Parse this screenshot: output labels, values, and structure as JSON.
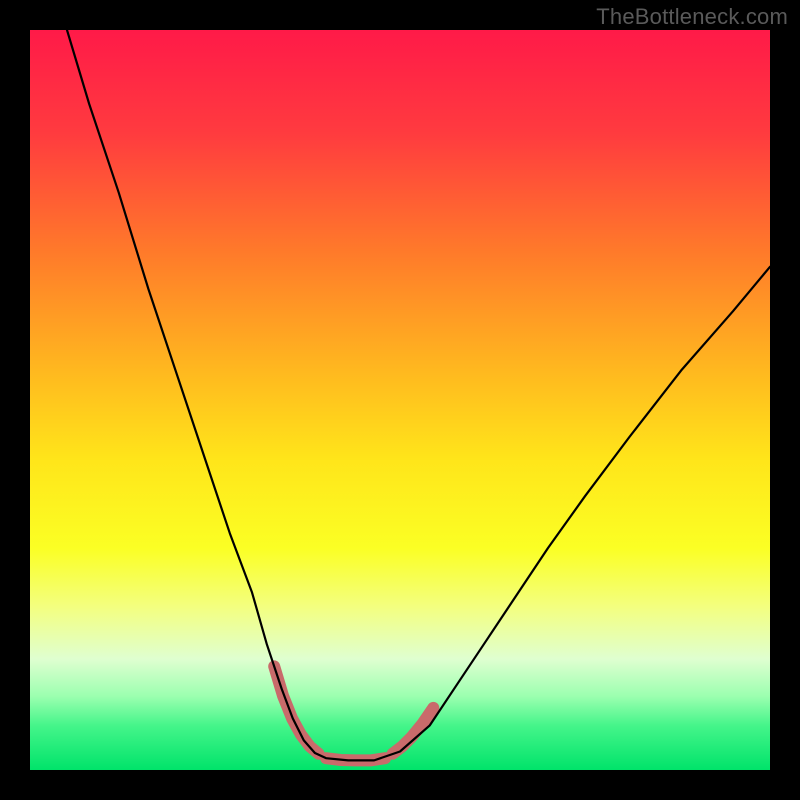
{
  "watermark": "TheBottleneck.com",
  "chart_data": {
    "type": "line",
    "title": "",
    "xlabel": "",
    "ylabel": "",
    "xlim": [
      0,
      100
    ],
    "ylim": [
      0,
      100
    ],
    "grid": false,
    "legend": false,
    "gradient_stops": [
      {
        "offset": 0.0,
        "color": "#ff1a48"
      },
      {
        "offset": 0.14,
        "color": "#ff3b3f"
      },
      {
        "offset": 0.3,
        "color": "#ff7a2a"
      },
      {
        "offset": 0.46,
        "color": "#ffb81f"
      },
      {
        "offset": 0.58,
        "color": "#ffe51a"
      },
      {
        "offset": 0.7,
        "color": "#fbff24"
      },
      {
        "offset": 0.78,
        "color": "#f3ff80"
      },
      {
        "offset": 0.85,
        "color": "#dfffd0"
      },
      {
        "offset": 0.9,
        "color": "#9cffb0"
      },
      {
        "offset": 0.94,
        "color": "#45f58a"
      },
      {
        "offset": 1.0,
        "color": "#00e36a"
      }
    ],
    "series": [
      {
        "name": "bottleneck-curve",
        "color": "#000000",
        "stroke_width": 2.2,
        "x": [
          5,
          8,
          12,
          16,
          20,
          24,
          27,
          30,
          32,
          34,
          35.5,
          37,
          38.5,
          40,
          43,
          46.5,
          50,
          54,
          58,
          62,
          66,
          70,
          75,
          81,
          88,
          95,
          100
        ],
        "values": [
          100,
          90,
          78,
          65,
          53,
          41,
          32,
          24,
          17,
          11,
          7,
          4,
          2.3,
          1.6,
          1.3,
          1.3,
          2.5,
          6,
          12,
          18,
          24,
          30,
          37,
          45,
          54,
          62,
          68
        ]
      }
    ],
    "highlight": {
      "name": "marker-band",
      "color": "#c96b6b",
      "stroke_width": 12,
      "linecap": "round",
      "segments": [
        {
          "x": [
            33,
            34.2,
            35.4,
            36.6,
            37.8,
            39
          ],
          "values": [
            14,
            10,
            7,
            4.8,
            3.2,
            2.2
          ]
        },
        {
          "x": [
            40,
            42,
            44,
            46,
            48
          ],
          "values": [
            1.6,
            1.35,
            1.3,
            1.3,
            1.6
          ]
        },
        {
          "x": [
            49,
            50.3,
            51.6,
            53,
            54.5
          ],
          "values": [
            2.2,
            3.2,
            4.5,
            6.2,
            8.4
          ]
        }
      ]
    }
  }
}
